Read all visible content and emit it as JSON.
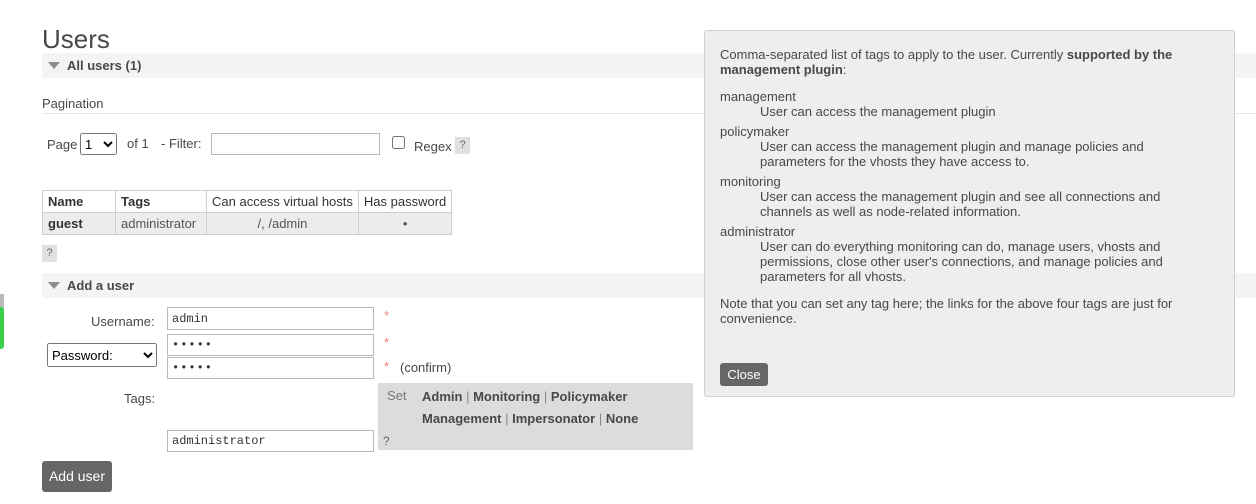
{
  "page": {
    "title": "Users"
  },
  "all_users": {
    "header": "All users (1)",
    "pagination_label": "Pagination",
    "page_label": "Page",
    "page_value": "1",
    "of_label": "of 1",
    "filter_label": "- Filter:",
    "filter_value": "",
    "regex_label": "Regex",
    "help": "?",
    "table": {
      "columns": [
        "Name",
        "Tags",
        "Can access virtual hosts",
        "Has password"
      ],
      "rows": [
        {
          "name": "guest",
          "tags": "administrator",
          "vhosts": "/, /admin",
          "has_password": "•"
        }
      ]
    },
    "table_help": "?"
  },
  "add_user": {
    "header": "Add a user",
    "username_label": "Username:",
    "username_value": "admin",
    "password_select": "Password:",
    "password_value": "•••••",
    "confirm_value": "•••••",
    "required": "*",
    "confirm_label": "(confirm)",
    "tags_label": "Tags:",
    "set_label": "Set",
    "tag_links": [
      "Admin",
      "Monitoring",
      "Policymaker",
      "Management",
      "Impersonator",
      "None"
    ],
    "separator": "|",
    "tags_value": "administrator",
    "tags_help": "?",
    "submit_label": "Add user"
  },
  "help_popup": {
    "intro_plain": "Comma-separated list of tags to apply to the user. Currently ",
    "intro_bold_1": "supported by the",
    "intro_bold_2": "management plugin",
    "intro_colon": ":",
    "items": [
      {
        "term": "management",
        "desc": [
          "User can access the management plugin"
        ]
      },
      {
        "term": "policymaker",
        "desc": [
          "User can access the management plugin and manage policies and",
          "parameters for the vhosts they have access to."
        ]
      },
      {
        "term": "monitoring",
        "desc": [
          "User can access the management plugin and see all connections and",
          "channels as well as node-related information."
        ]
      },
      {
        "term": "administrator",
        "desc": [
          "User can do everything monitoring can do, manage users, vhosts and",
          "permissions, close other user's connections, and manage policies and",
          "parameters for all vhosts."
        ]
      }
    ],
    "note_line1": "Note that you can set any tag here; the links for the above four tags are just for",
    "note_line2": "convenience.",
    "close_label": "Close"
  }
}
